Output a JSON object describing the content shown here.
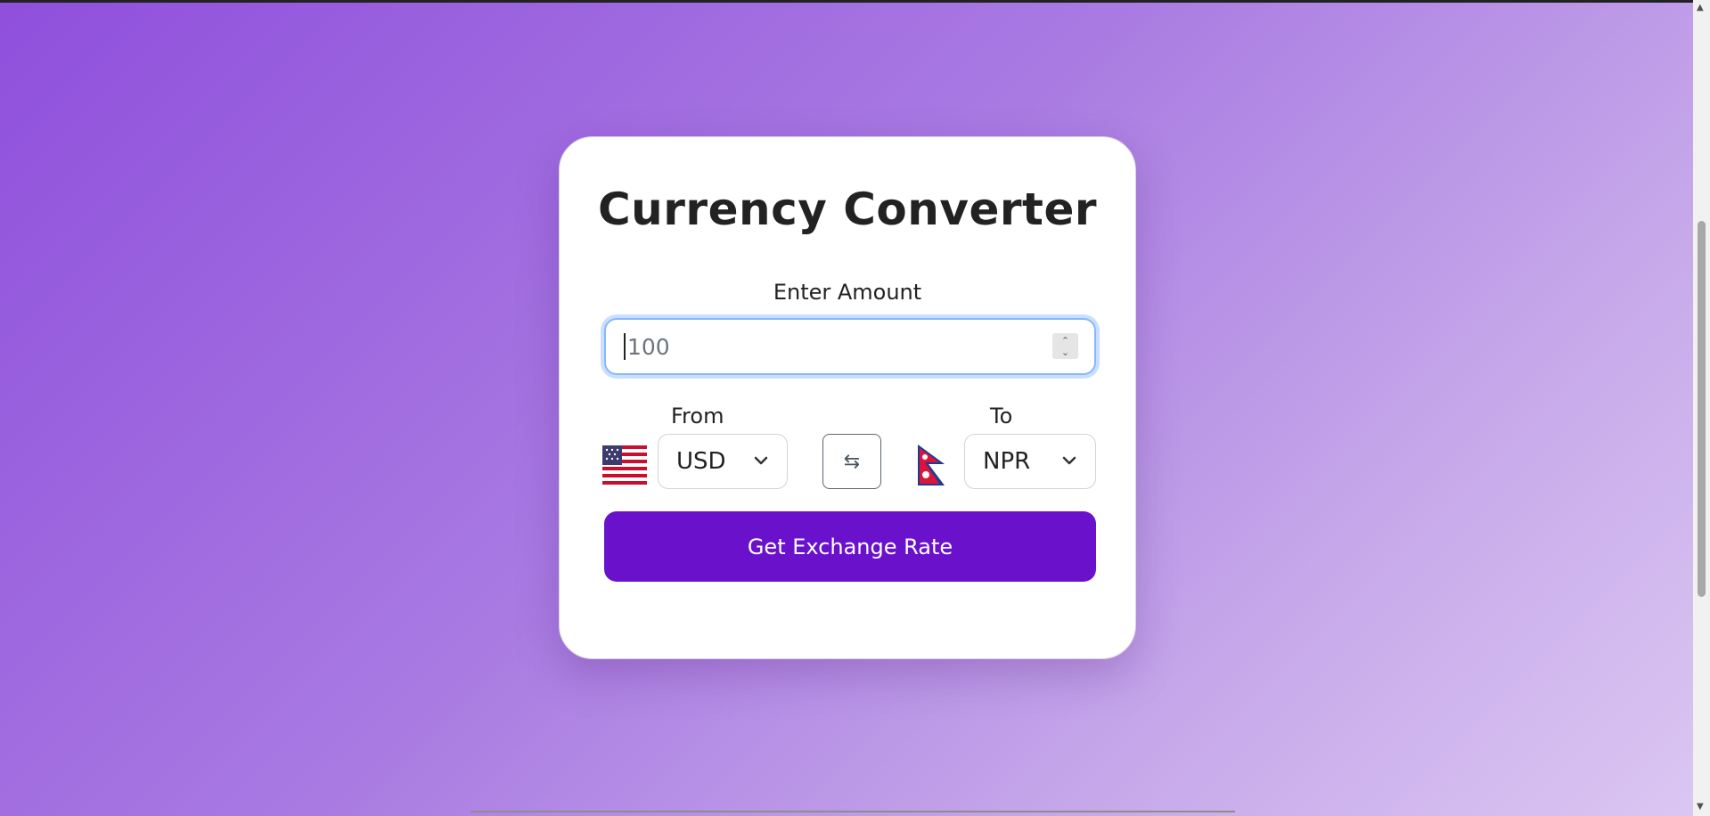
{
  "app": {
    "title": "Currency Converter"
  },
  "amount": {
    "label": "Enter Amount",
    "placeholder": "100"
  },
  "from": {
    "label": "From",
    "currency": "USD",
    "flag": "us-flag"
  },
  "to": {
    "label": "To",
    "currency": "NPR",
    "flag": "nepal-flag"
  },
  "swap": {
    "icon": "⇆"
  },
  "button": {
    "label": "Get Exchange Rate"
  },
  "colors": {
    "primary": "#6a11cb",
    "focus_border": "#86b7fe",
    "background_start": "#8f4fdc",
    "background_end": "#dcc7f2"
  }
}
